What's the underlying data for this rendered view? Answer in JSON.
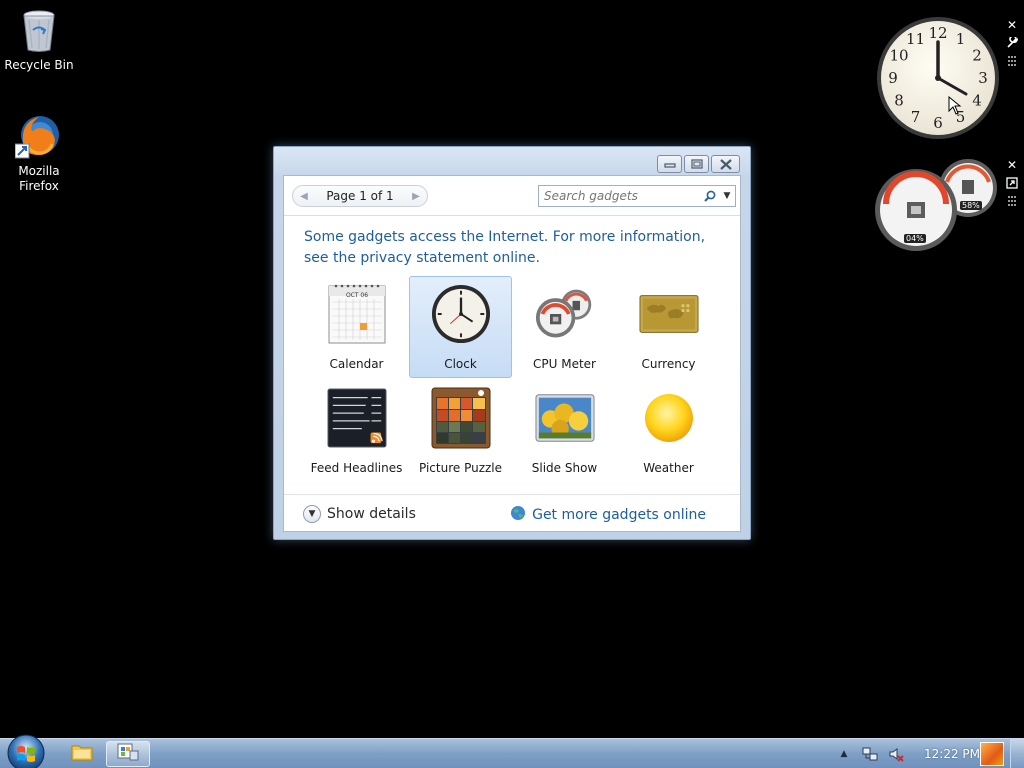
{
  "desktop": {
    "icons": [
      {
        "label": "Recycle Bin",
        "icon": "recycle-bin-icon"
      },
      {
        "label": "Mozilla\nFirefox",
        "icon": "firefox-icon"
      }
    ]
  },
  "gadget_window": {
    "controls": [
      "minimize",
      "maximize",
      "close"
    ],
    "pager": {
      "label": "Page 1 of 1"
    },
    "search": {
      "placeholder": "Search gadgets"
    },
    "notice": "Some gadgets access the Internet.  For more information, see the privacy statement online.",
    "gadgets": [
      {
        "name": "Calendar",
        "selected": false,
        "icon": "calendar-icon",
        "calendar_month": "OCT 06"
      },
      {
        "name": "Clock",
        "selected": true,
        "icon": "clock-icon"
      },
      {
        "name": "CPU Meter",
        "selected": false,
        "icon": "cpu-meter-icon"
      },
      {
        "name": "Currency",
        "selected": false,
        "icon": "currency-icon"
      },
      {
        "name": "Feed Headlines",
        "selected": false,
        "icon": "feed-headlines-icon"
      },
      {
        "name": "Picture Puzzle",
        "selected": false,
        "icon": "picture-puzzle-icon"
      },
      {
        "name": "Slide Show",
        "selected": false,
        "icon": "slide-show-icon"
      },
      {
        "name": "Weather",
        "selected": false,
        "icon": "weather-icon"
      }
    ],
    "footer": {
      "show_details": "Show details",
      "get_more": "Get more gadgets online"
    }
  },
  "desktop_gadgets": {
    "clock": {
      "numerals": [
        "12",
        "1",
        "2",
        "3",
        "4",
        "5",
        "6",
        "7",
        "8",
        "9",
        "10",
        "11"
      ]
    },
    "cpu_meter": {
      "cpu_percent": "04%",
      "memory_percent": "58%"
    }
  },
  "taskbar": {
    "time": "12:22 PM"
  },
  "colors": {
    "link": "#1e5d9e",
    "selection": "#c6dcf5",
    "taskbar": "#7fa0c6"
  }
}
